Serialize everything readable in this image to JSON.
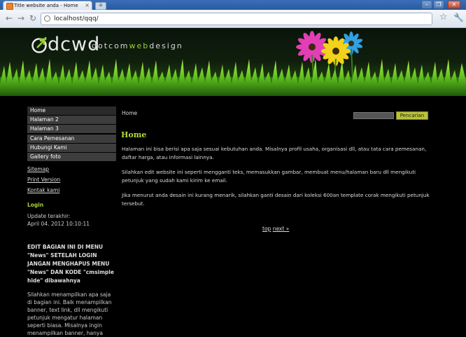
{
  "browser": {
    "tab_title": "Title website anda - Home",
    "tab_close": "×",
    "new_tab": "+",
    "url": "localhost/qqq/",
    "win_min": "–",
    "win_max": "❐",
    "win_close": "✕"
  },
  "header": {
    "logo": "dcwd",
    "tagline_a": "dotcom",
    "tagline_b": "web",
    "tagline_c": "design"
  },
  "sidebar": {
    "menu": [
      "Home",
      "Halaman 2",
      "Halaman 3",
      "Cara Pemesanan",
      "Hubungi Kami",
      "Gallery foto"
    ],
    "links": [
      "Sitemap",
      "Print Version",
      "Kontak kami"
    ],
    "login_heading": "Login",
    "update_label": "Update terakhir:",
    "update_value": "April 04. 2012 10:10:11",
    "edit_notice": "EDIT BAGIAN INI DI MENU \"News\" SETELAH LOGIN JANGAN MENGHAPUS MENU \"News\" DAN KODE \"cmsimple hide\" dibawahnya",
    "note": "Silahkan menampilkan apa saja di bagian ini. Baik menampilkan banner, text link, dll mengikuti petunjuk mengatur halaman seperti biasa. Misalnya ingin menampilkan banner, hanya"
  },
  "main": {
    "breadcrumb": "Home",
    "search_button": "Pencarian",
    "title": "Home",
    "paragraphs": [
      "Halaman ini bisa berisi apa saja sesuai kebutuhan anda. Misalnya profil usaha, organisasi dll, atau tata cara pemesanan, daftar harga, atau informasi lainnya.",
      "Silahkan edit website ini seperti mengganti teks, memasukkan gambar, membuat menu/halaman baru dll mengikuti petunjuk yang sudah kami kirim ke email.",
      "Jika menurut anda desain ini kurang menarik, silahkan ganti desain dari koleksi 600an template corak mengikuti petunjuk tersebut."
    ],
    "pager_top": "top",
    "pager_next": "next »"
  },
  "colors": {
    "accent_green": "#b5d93a",
    "search_button": "#b9c23a",
    "menu_bg": "#3d3d3d"
  }
}
